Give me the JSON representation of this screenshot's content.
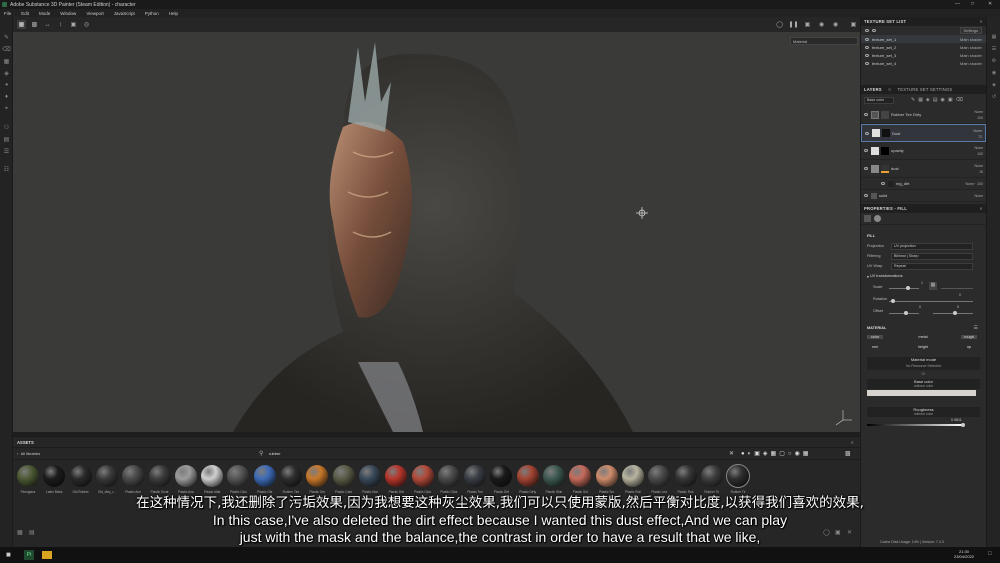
{
  "window": {
    "title": "Adobe Substance 3D Painter (Steam Edition) - character"
  },
  "menu": [
    "File",
    "Edit",
    "Mode",
    "Window",
    "Viewport",
    "JavaScript",
    "Python",
    "Help"
  ],
  "viewport": {
    "display_select": "Material"
  },
  "texture_set_list": {
    "header": "TEXTURE SET LIST",
    "settings_label": "Settings",
    "items": [
      {
        "name": "texture_set_1",
        "shader": "Main shader"
      },
      {
        "name": "texture_set_2",
        "shader": "Main shader"
      },
      {
        "name": "texture_set_3",
        "shader": "Main shader"
      },
      {
        "name": "texture_set_4",
        "shader": "Main shader"
      }
    ]
  },
  "layers": {
    "tab_layers": "LAYERS",
    "tab_settings": "TEXTURE SET SETTINGS",
    "channel": "Base color",
    "items": [
      {
        "name": "Rubber Tire Dirty",
        "blend": "Norm",
        "opacity": "100"
      },
      {
        "name": "Dust",
        "blend": "Norm",
        "opacity": "72"
      },
      {
        "name": "opacity",
        "blend": "Norm",
        "opacity": "100"
      },
      {
        "name": "dust",
        "blend": "Norm",
        "opacity": "15"
      },
      {
        "name": "mg_dirt",
        "blend": "Norm",
        "opacity": "100"
      },
      {
        "name": "solid",
        "blend": "Norm",
        "opacity": ""
      }
    ]
  },
  "properties": {
    "header": "PROPERTIES - FILL",
    "fill_label": "FILL",
    "projection_label": "Projection",
    "projection_value": "UV projection",
    "filtering_label": "Filtering",
    "filtering_value": "Bilinear | Sharp",
    "uvwrap_label": "UV Wrap",
    "uvwrap_value": "Repeat",
    "uvtrans_label": "UV transformations",
    "scale_label": "Scale",
    "scale_value": "1",
    "rotation_label": "Rotation",
    "rotation_value": "0",
    "offset_label": "Offset",
    "offset_value_1": "0",
    "offset_value_2": "0",
    "material_label": "MATERIAL",
    "chips": [
      "color",
      "metal",
      "rough",
      "nrm",
      "height",
      "op"
    ],
    "material_mode": "Material mode",
    "no_resource": "No Resource Selected",
    "or_label": "Or",
    "base_color_label": "Base color",
    "base_color_sub": "uniform color",
    "roughness_label": "Roughness",
    "roughness_sub": "uniform color",
    "roughness_value": "0.9811"
  },
  "assets": {
    "header": "ASSETS",
    "all_libraries": "All libraries",
    "search_value": "rubber",
    "materials": [
      "Fiberglass",
      "Latex Black",
      "Old Rubber",
      "Old_dirty_r...",
      "Plastic Arm",
      "Plastic Scrat",
      "Plastic Ana",
      "Plastic Matt",
      "Plastic Glos",
      "Plastic Gla",
      "Rubber Tire",
      "Plastic Orn",
      "Plastic Carb",
      "Plastic Mat",
      "Plastic Dirt",
      "Plastic Clea",
      "Plastic Glea",
      "Plastic Ten",
      "Plastic Dirt",
      "Plastic Dirty",
      "Plastic Shin",
      "Plastic Sof",
      "Plastic Scr",
      "Plastic Roll",
      "Plastic Lea",
      "Plastic Rub",
      "Rubber Tir",
      "Rubber Tir"
    ]
  },
  "subtitles": {
    "cn": "在这种情况下,我还删除了污垢效果,因为我想要这种灰尘效果,我们可以只使用蒙版,然后平衡对比度,以获得我们喜欢的效果,",
    "en1": "In this case,I've also deleted the dirt effect because I wanted this dust effect,And we can play",
    "en2": "just with the mask and the balance,the contrast in order to have a result that we like,"
  },
  "status": {
    "cache": "Cache Disk Usage:",
    "cache_value": "14% | Version: 7.4.3"
  },
  "taskbar": {
    "time": "21:30",
    "date": "23/04/2022"
  },
  "colors": {
    "accent": "#5a7aa8",
    "panel": "#2b2b2b",
    "viewport": "#3a3a38"
  }
}
